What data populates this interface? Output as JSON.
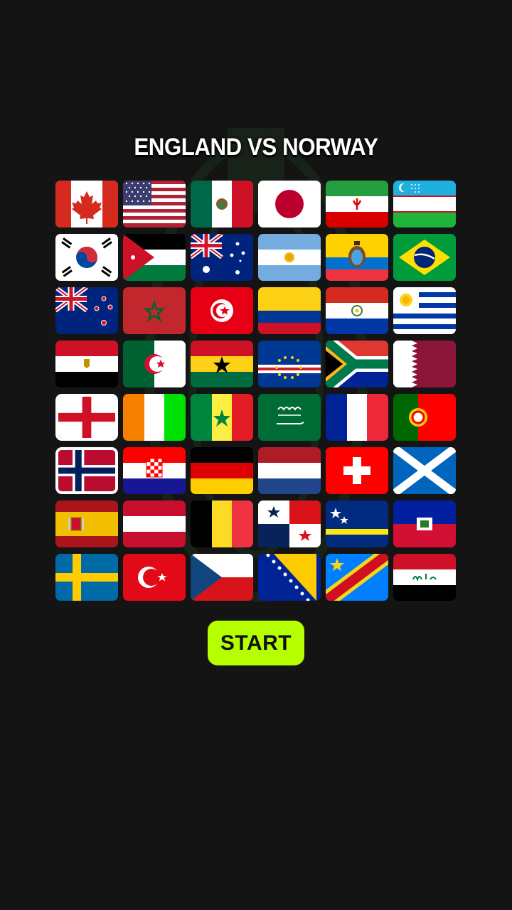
{
  "title": "ENGLAND VS NORWAY",
  "start_label": "START",
  "accent_color": "#b6ff00",
  "selected_teams": [
    "england",
    "norway"
  ],
  "flags": [
    "canada",
    "usa",
    "mexico",
    "japan",
    "iran",
    "uzbekistan",
    "south-korea",
    "jordan",
    "australia",
    "argentina",
    "ecuador",
    "brazil",
    "new-zealand",
    "morocco",
    "tunisia",
    "colombia",
    "paraguay",
    "uruguay",
    "egypt",
    "algeria",
    "ghana",
    "cape-verde",
    "south-africa",
    "qatar",
    "england",
    "ivory-coast",
    "senegal",
    "saudi-arabia",
    "france",
    "portugal",
    "norway",
    "croatia",
    "germany",
    "netherlands",
    "switzerland",
    "scotland",
    "spain",
    "austria",
    "belgium",
    "panama",
    "curacao",
    "haiti",
    "sweden",
    "turkey",
    "czech-republic",
    "bosnia",
    "dr-congo",
    "iraq"
  ]
}
